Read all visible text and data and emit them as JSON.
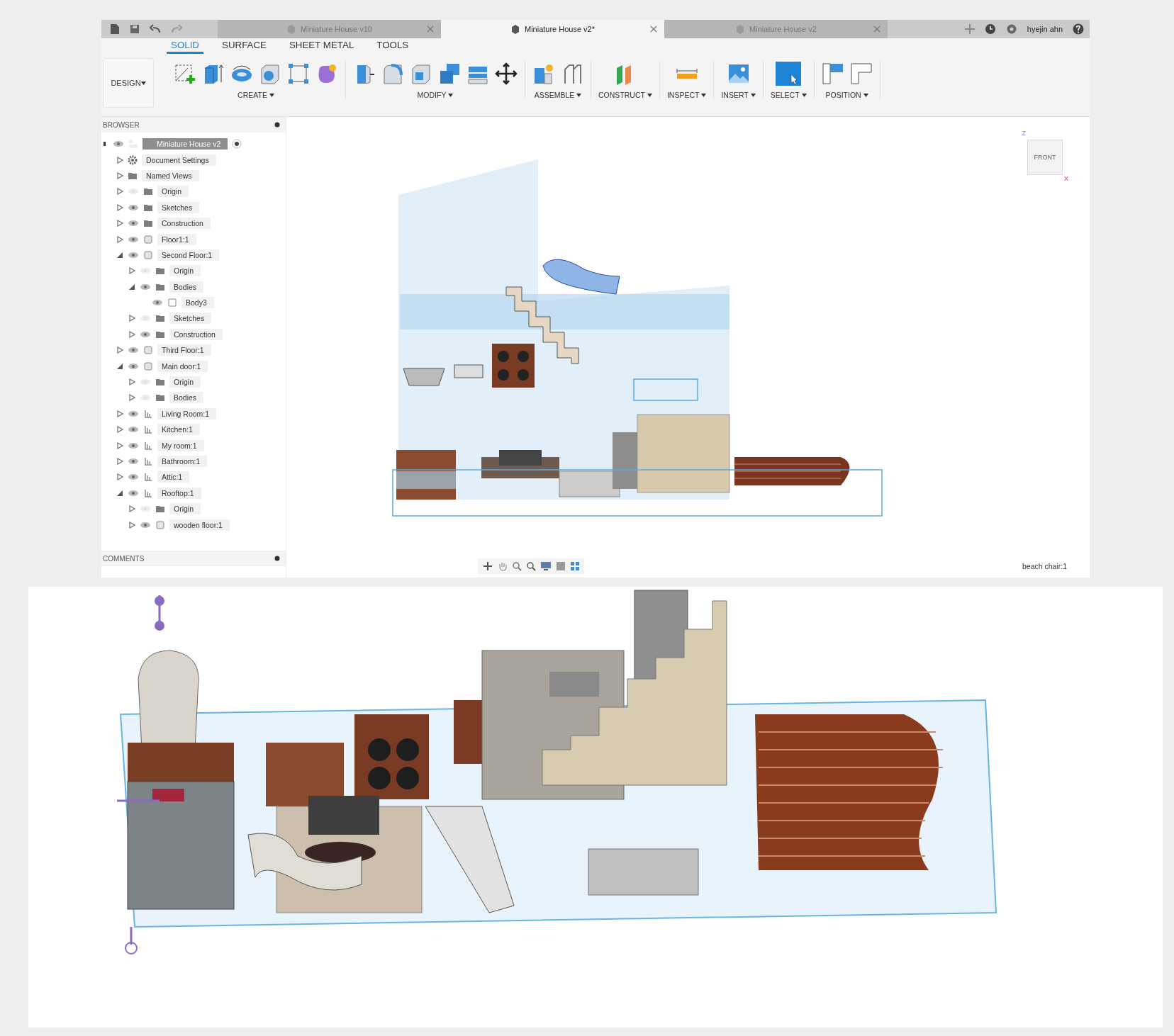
{
  "tab_bar": {
    "doc_tabs": [
      {
        "label": "Miniature House v10",
        "selected": false
      },
      {
        "label": "Miniature House v2*",
        "selected": true
      },
      {
        "label": "Miniature House v2",
        "selected": false
      }
    ],
    "user": "hyejin ahn"
  },
  "toolbar": {
    "workspace": "DESIGN",
    "tabs": [
      {
        "label": "SOLID",
        "selected": true
      },
      {
        "label": "SURFACE",
        "selected": false
      },
      {
        "label": "SHEET METAL",
        "selected": false
      },
      {
        "label": "TOOLS",
        "selected": false
      }
    ],
    "groups": [
      {
        "label": "CREATE"
      },
      {
        "label": "MODIFY"
      },
      {
        "label": "ASSEMBLE"
      },
      {
        "label": "CONSTRUCT"
      },
      {
        "label": "INSPECT"
      },
      {
        "label": "INSERT"
      },
      {
        "label": "SELECT"
      },
      {
        "label": "POSITION"
      }
    ]
  },
  "browser": {
    "title": "BROWSER",
    "tree": [
      {
        "label": "Miniature House v2",
        "kind": "assembly",
        "visible": true,
        "selected": true,
        "children": [
          {
            "label": "Document Settings",
            "kind": "settings",
            "expanded": false,
            "selected": false
          },
          {
            "label": "Named Views",
            "kind": "folder",
            "expanded": false,
            "selected": false
          },
          {
            "label": "Origin",
            "kind": "folder",
            "visible": false,
            "expanded": false,
            "selected": false
          },
          {
            "label": "Sketches",
            "kind": "folder",
            "visible": true,
            "expanded": false,
            "selected": false
          },
          {
            "label": "Construction",
            "kind": "folder",
            "visible": true,
            "expanded": false,
            "selected": false
          },
          {
            "label": "Floor1:1",
            "kind": "component",
            "visible": true,
            "expanded": false,
            "selected": false
          },
          {
            "label": "Second Floor:1",
            "kind": "component",
            "visible": true,
            "expanded": true,
            "selected": false,
            "children": [
              {
                "label": "Origin",
                "kind": "folder",
                "visible": false,
                "expanded": false,
                "selected": false
              },
              {
                "label": "Bodies",
                "kind": "folder",
                "visible": true,
                "expanded": true,
                "selected": false,
                "children": [
                  {
                    "label": "Body3",
                    "kind": "body",
                    "visible": true,
                    "selected": false
                  }
                ]
              },
              {
                "label": "Sketches",
                "kind": "folder",
                "visible": false,
                "expanded": false,
                "selected": false
              },
              {
                "label": "Construction",
                "kind": "folder",
                "visible": true,
                "expanded": false,
                "selected": false
              }
            ]
          },
          {
            "label": "Third Floor:1",
            "kind": "component",
            "visible": true,
            "expanded": false,
            "selected": false
          },
          {
            "label": "Main door:1",
            "kind": "component",
            "visible": true,
            "expanded": true,
            "selected": false,
            "children": [
              {
                "label": "Origin",
                "kind": "folder",
                "visible": false,
                "expanded": false,
                "selected": false
              },
              {
                "label": "Bodies",
                "kind": "folder",
                "visible": false,
                "expanded": false,
                "selected": false
              }
            ]
          },
          {
            "label": "Living Room:1",
            "kind": "linked",
            "visible": true,
            "expanded": false,
            "selected": false
          },
          {
            "label": "Kitchen:1",
            "kind": "linked",
            "visible": true,
            "expanded": false,
            "selected": false
          },
          {
            "label": "My room:1",
            "kind": "linked",
            "visible": true,
            "expanded": false,
            "selected": false
          },
          {
            "label": "Bathroom:1",
            "kind": "linked",
            "visible": true,
            "expanded": false,
            "selected": false
          },
          {
            "label": "Attic:1",
            "kind": "linked",
            "visible": true,
            "expanded": false,
            "selected": false
          },
          {
            "label": "Rooftop:1",
            "kind": "linked",
            "visible": true,
            "expanded": true,
            "selected": false,
            "children": [
              {
                "label": "Origin",
                "kind": "folder",
                "visible": false,
                "expanded": false,
                "selected": false
              },
              {
                "label": "wooden floor:1",
                "kind": "component",
                "visible": true,
                "expanded": false,
                "selected": false
              }
            ]
          }
        ]
      }
    ],
    "comments_title": "COMMENTS"
  },
  "viewport": {
    "view_cube": {
      "face": "FRONT",
      "axis_up": "Z",
      "axis_side": "X"
    },
    "status": "beach chair:1"
  }
}
